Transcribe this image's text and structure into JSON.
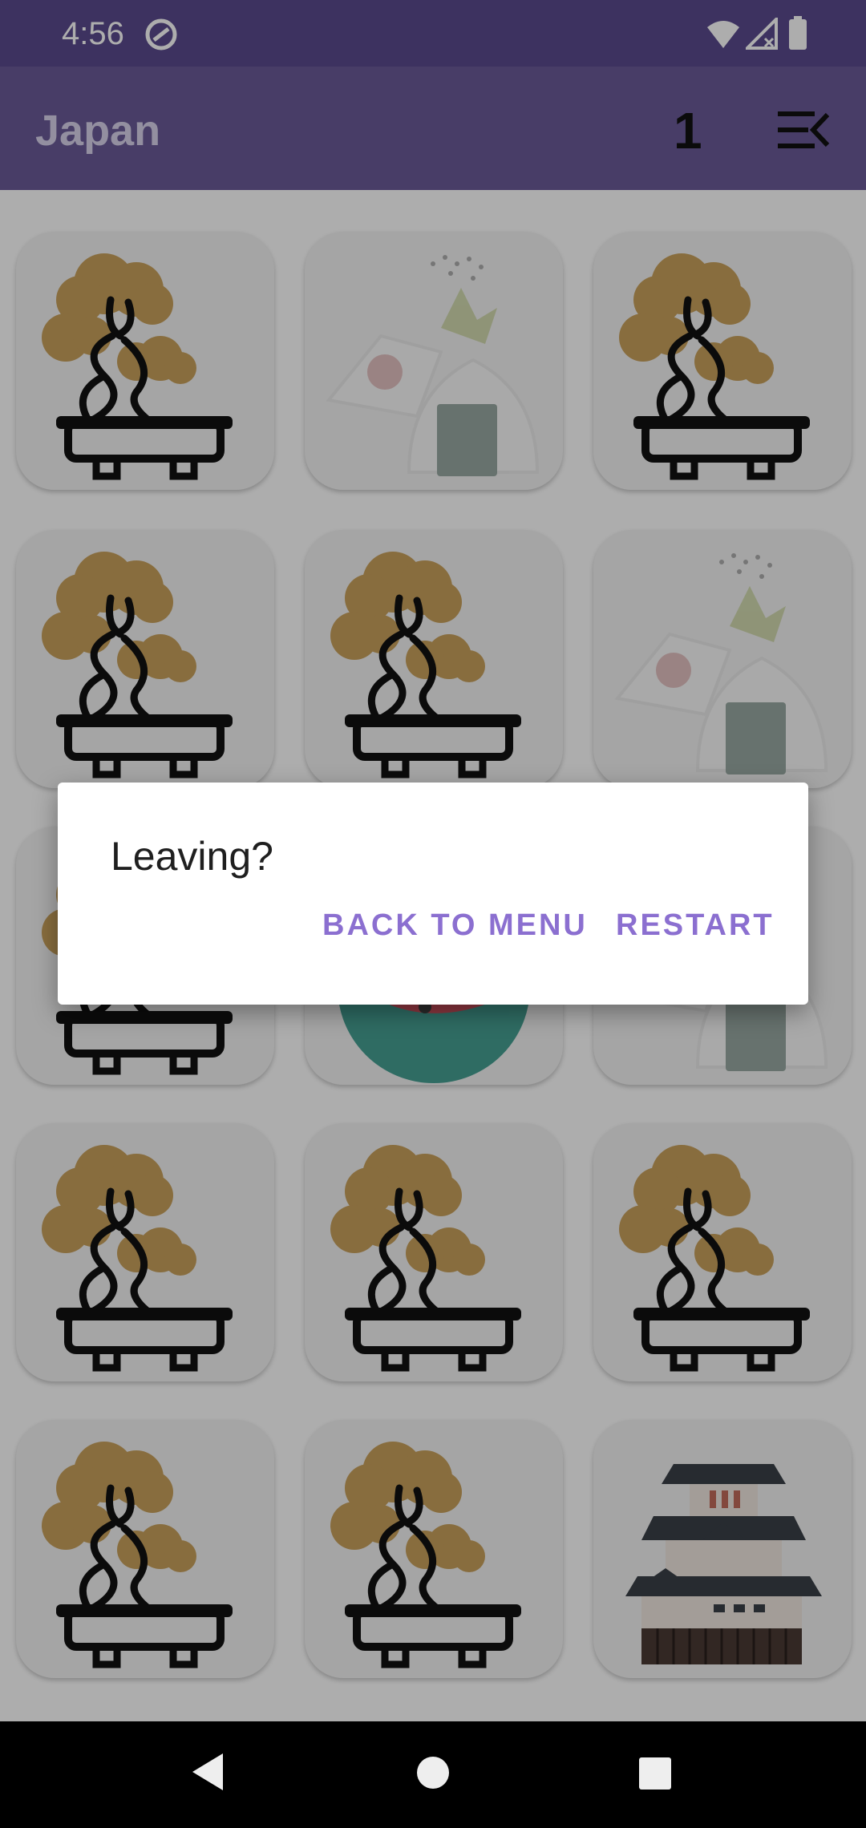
{
  "status_bar": {
    "time": "4:56",
    "icons": [
      "app-notification-icon",
      "wifi-icon",
      "cell-signal-icon",
      "battery-icon"
    ]
  },
  "app_bar": {
    "title": "Japan",
    "score": "1",
    "menu_icon": "menu-collapse-icon"
  },
  "board": {
    "cards": [
      {
        "icon": "bonsai-icon"
      },
      {
        "icon": "onigiri-icon"
      },
      {
        "icon": "bonsai-icon"
      },
      {
        "icon": "bonsai-icon"
      },
      {
        "icon": "bonsai-icon"
      },
      {
        "icon": "onigiri-icon"
      },
      {
        "icon": "bonsai-icon"
      },
      {
        "icon": "koi-icon"
      },
      {
        "icon": "onigiri-icon"
      },
      {
        "icon": "bonsai-icon"
      },
      {
        "icon": "bonsai-icon"
      },
      {
        "icon": "bonsai-icon"
      },
      {
        "icon": "bonsai-icon"
      },
      {
        "icon": "bonsai-icon"
      },
      {
        "icon": "castle-icon"
      }
    ]
  },
  "dialog": {
    "title": "Leaving?",
    "back_to_menu_label": "BACK TO MENU",
    "restart_label": "RESTART"
  },
  "colors": {
    "accent": "#8b6fd0",
    "app_bar": "#6a5b98",
    "bonsai_foliage": "#c9a15c"
  },
  "nav_bar": {
    "icons": [
      "back-icon",
      "home-icon",
      "recents-icon"
    ]
  }
}
